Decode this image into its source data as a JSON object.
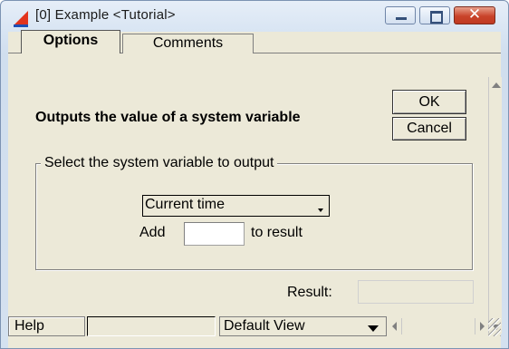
{
  "window": {
    "title": "[0]  Example  <Tutorial>",
    "minimize_icon": "minimize-icon",
    "maximize_icon": "maximize-icon",
    "close_icon": "close-icon",
    "close_glyph": "✕"
  },
  "tabs": [
    {
      "label": "Options",
      "selected": true
    },
    {
      "label": "Comments",
      "selected": false
    }
  ],
  "content": {
    "heading": "Outputs the value of a system variable",
    "ok_label": "OK",
    "cancel_label": "Cancel",
    "group_label": "Select the system variable to output",
    "variable_select": "Current time",
    "add_label": "Add",
    "add_value": "",
    "to_result_label": "to result",
    "result_label": "Result:",
    "result_value": ""
  },
  "statusbar": {
    "help_label": "Help",
    "status_value": "",
    "view_select": "Default View"
  },
  "colors": {
    "close_button": "#c9432a",
    "title_bar": "#d6e3f2",
    "dialog_face": "#ece9d8"
  }
}
